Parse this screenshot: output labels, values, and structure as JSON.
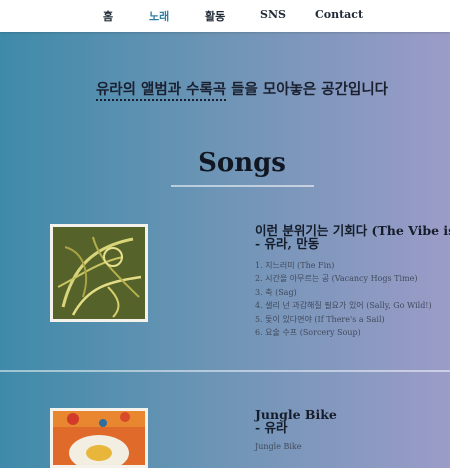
{
  "nav": {
    "items": [
      {
        "label": "홈"
      },
      {
        "label": "노래"
      },
      {
        "label": "활동"
      },
      {
        "label": "SNS"
      },
      {
        "label": "Contact"
      }
    ],
    "active_color": "#2f7fa5"
  },
  "intro": {
    "underlined": "유라의 앨범과 수록곡",
    "rest": " 들을 모아놓은 공간입니다"
  },
  "songs": {
    "heading": "Songs",
    "albums": [
      {
        "title_line1": "이런 분위기는 기회다 (The Vibe is a",
        "title_line2": "- 유라, 만동",
        "tracks": [
          "1. 지느러미 (The Fin)",
          "2. 시간을 아무르는 공 (Vacancy Hogs Time)",
          "3. 축 (Sag)",
          "4. 샐리 넌 과감해질 필요가 있어 (Sally, Go Wild!)",
          "5. 돛이 있다면야 (If There's a Sail)",
          "6. 요술 수프 (Sorcery Soup)"
        ]
      },
      {
        "title_line1": "Jungle Bike",
        "title_line2": "- 유라",
        "tracks": [
          "Jungle Bike"
        ]
      }
    ]
  },
  "colors": {
    "gradient_left": "#3f8aa9",
    "gradient_right": "#9b9cc8",
    "navbar": "#ffffff"
  }
}
